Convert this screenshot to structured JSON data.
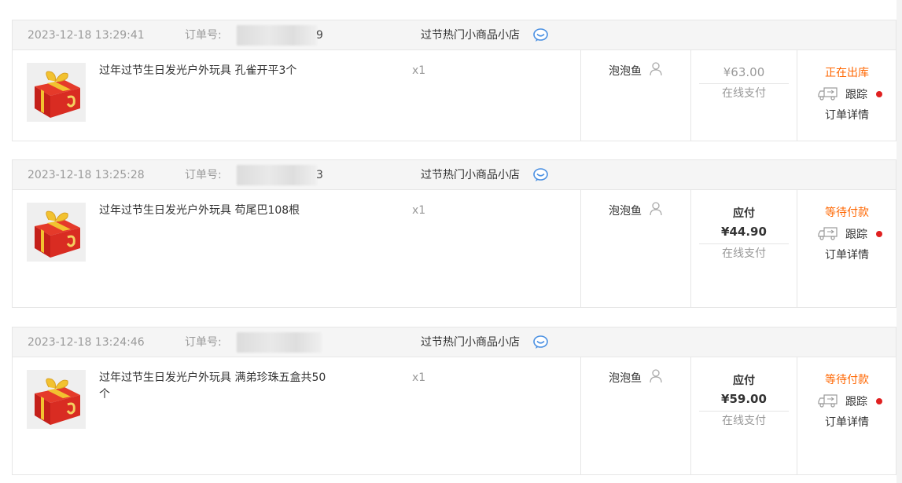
{
  "orders": [
    {
      "date": "2023-12-18 13:29:41",
      "order_no_label": "订单号:",
      "order_no_tail": "9",
      "shop": "过节热门小商品小店",
      "title": "过年过节生日发光户外玩具 孔雀开平3个",
      "qty": "x1",
      "buyer": "泡泡鱼",
      "pay_label": "",
      "amount": "¥63.00",
      "pay_method": "在线支付",
      "status": "正在出库",
      "track": "跟踪",
      "detail": "订单详情"
    },
    {
      "date": "2023-12-18 13:25:28",
      "order_no_label": "订单号:",
      "order_no_tail": "3",
      "shop": "过节热门小商品小店",
      "title": "过年过节生日发光户外玩具 苟尾巴108根",
      "qty": "x1",
      "buyer": "泡泡鱼",
      "pay_label": "应付",
      "amount": "¥44.90",
      "pay_method": "在线支付",
      "status": "等待付款",
      "track": "跟踪",
      "detail": "订单详情"
    },
    {
      "date": "2023-12-18 13:24:46",
      "order_no_label": "订单号:",
      "order_no_tail": "",
      "shop": "过节热门小商品小店",
      "title": "过年过节生日发光户外玩具 满弟珍珠五盒共50个",
      "qty": "x1",
      "buyer": "泡泡鱼",
      "pay_label": "应付",
      "amount": "¥59.00",
      "pay_method": "在线支付",
      "status": "等待付款",
      "track": "跟踪",
      "detail": "订单详情"
    }
  ],
  "colors": {
    "status": "#ff6600",
    "header_bg": "#f5f5f5",
    "border": "#e6e6e6",
    "muted": "#999999",
    "chat_icon": "#4a90e2",
    "dot": "#e02020"
  },
  "icons": {
    "chat": "chat-bubble-icon",
    "buyer": "user-outline-icon",
    "track": "truck-icon",
    "thumb": "gift-box-icon"
  }
}
